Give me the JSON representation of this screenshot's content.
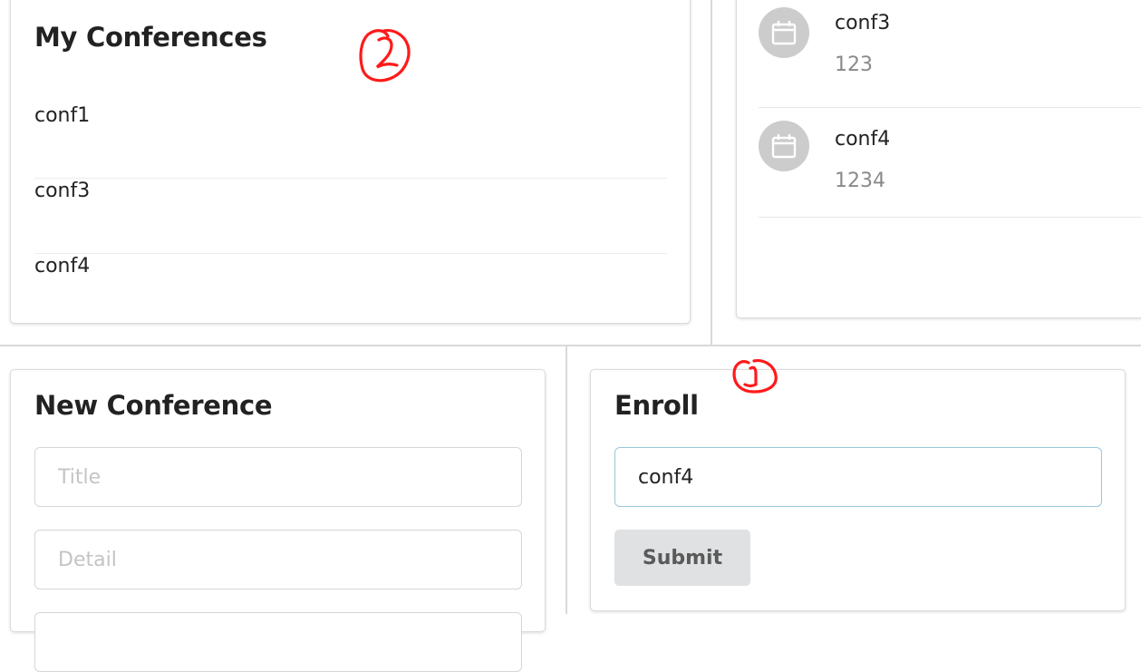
{
  "my_conferences": {
    "title": "My Conferences",
    "items": [
      "conf1",
      "conf3",
      "conf4"
    ]
  },
  "conference_list": {
    "items": [
      {
        "title": "conf3",
        "description": "123",
        "icon": "calendar-icon"
      },
      {
        "title": "conf4",
        "description": "1234",
        "icon": "calendar-icon"
      }
    ]
  },
  "new_conference": {
    "title": "New Conference",
    "title_placeholder": "Title",
    "detail_placeholder": "Detail"
  },
  "enroll": {
    "title": "Enroll",
    "input_value": "conf4",
    "submit_label": "Submit"
  },
  "annotations": {
    "marker_1": "1",
    "marker_2": "2"
  },
  "colors": {
    "annotation": "#ff1a1a",
    "avatar": "#cccccc",
    "button_bg": "#e0e1e2",
    "focus_border": "#96c8da"
  }
}
